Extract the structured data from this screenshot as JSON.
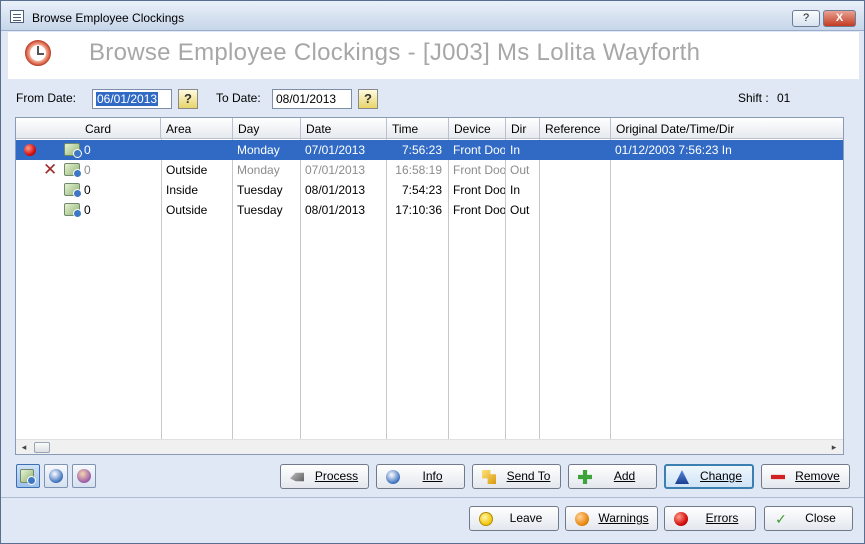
{
  "window": {
    "title": "Browse Employee Clockings",
    "help_label": "?",
    "close_label": "X"
  },
  "banner": {
    "heading": "Browse Employee Clockings - [J003] Ms Lolita Wayforth"
  },
  "filters": {
    "from_label": "From Date:",
    "from_value": "06/01/2013",
    "to_label": "To Date:",
    "to_value": "08/01/2013",
    "lookup_label": "?",
    "shift_label": "Shift :",
    "shift_value": "01"
  },
  "grid": {
    "columns": [
      "Card",
      "Area",
      "Day",
      "Date",
      "Time",
      "Device",
      "Dir",
      "Reference",
      "Original Date/Time/Dir"
    ],
    "rows": [
      {
        "status": "error",
        "card": "0",
        "area": "",
        "day": "Monday",
        "date": "07/01/2013",
        "time": "7:56:23",
        "device": "Front Door",
        "dir": "In",
        "reference": "",
        "original": "01/12/2003  7:56:23 In"
      },
      {
        "status": "deleted",
        "card": "0",
        "area": "Outside",
        "day": "Monday",
        "date": "07/01/2013",
        "time": "16:58:19",
        "device": "Front Door",
        "dir": "Out",
        "reference": "",
        "original": ""
      },
      {
        "status": "none",
        "card": "0",
        "area": "Inside",
        "day": "Tuesday",
        "date": "08/01/2013",
        "time": "7:54:23",
        "device": "Front Door",
        "dir": "In",
        "reference": "",
        "original": ""
      },
      {
        "status": "none",
        "card": "0",
        "area": "Outside",
        "day": "Tuesday",
        "date": "08/01/2013",
        "time": "17:10:36",
        "device": "Front Door",
        "dir": "Out",
        "reference": "",
        "original": ""
      }
    ],
    "scroll_left": "◂",
    "scroll_right": "▸"
  },
  "actions": {
    "process": "Process",
    "info": "Info",
    "send_to": "Send To",
    "add": "Add",
    "change": "Change",
    "remove": "Remove"
  },
  "footer": {
    "leave": "Leave",
    "warnings": "Warnings",
    "errors": "Errors",
    "close": "Close",
    "close_glyph": "✓"
  },
  "colors": {
    "selection": "#316ac5",
    "deleted_text": "#8c8c8c",
    "error_red": "#d4100f"
  }
}
